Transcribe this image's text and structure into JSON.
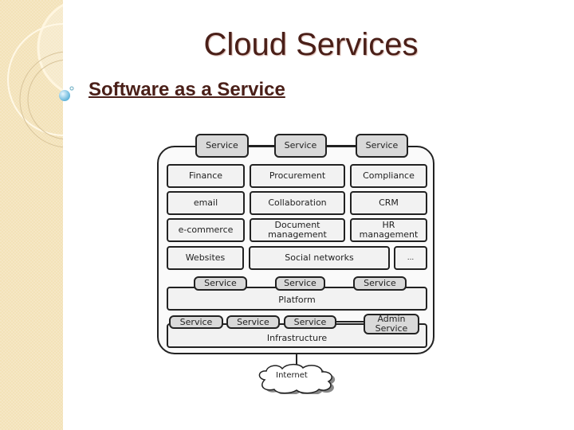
{
  "slide": {
    "title": "Cloud Services",
    "bullet_icon": "bubble-bullet-icon",
    "subtitle": "Software as a Service",
    "colors": {
      "title": "#4a1f18",
      "sidebar": "#f3e2b8",
      "bullet": "#7fc4e4"
    }
  },
  "diagram": {
    "top_services": [
      "Service",
      "Service",
      "Service"
    ],
    "application_rows": [
      [
        "Finance",
        "Procurement",
        "Compliance"
      ],
      [
        "email",
        "Collaboration",
        "CRM"
      ],
      [
        "e-commerce",
        "Document management",
        "HR management"
      ],
      [
        "Websites",
        "Social networks",
        "..."
      ]
    ],
    "platform": {
      "services": [
        "Service",
        "Service",
        "Service"
      ],
      "label": "Platform"
    },
    "infrastructure": {
      "services": [
        "Service",
        "Service",
        "Service"
      ],
      "admin_service": "Admin Service",
      "label": "Infrastructure"
    },
    "network": "Internet"
  }
}
